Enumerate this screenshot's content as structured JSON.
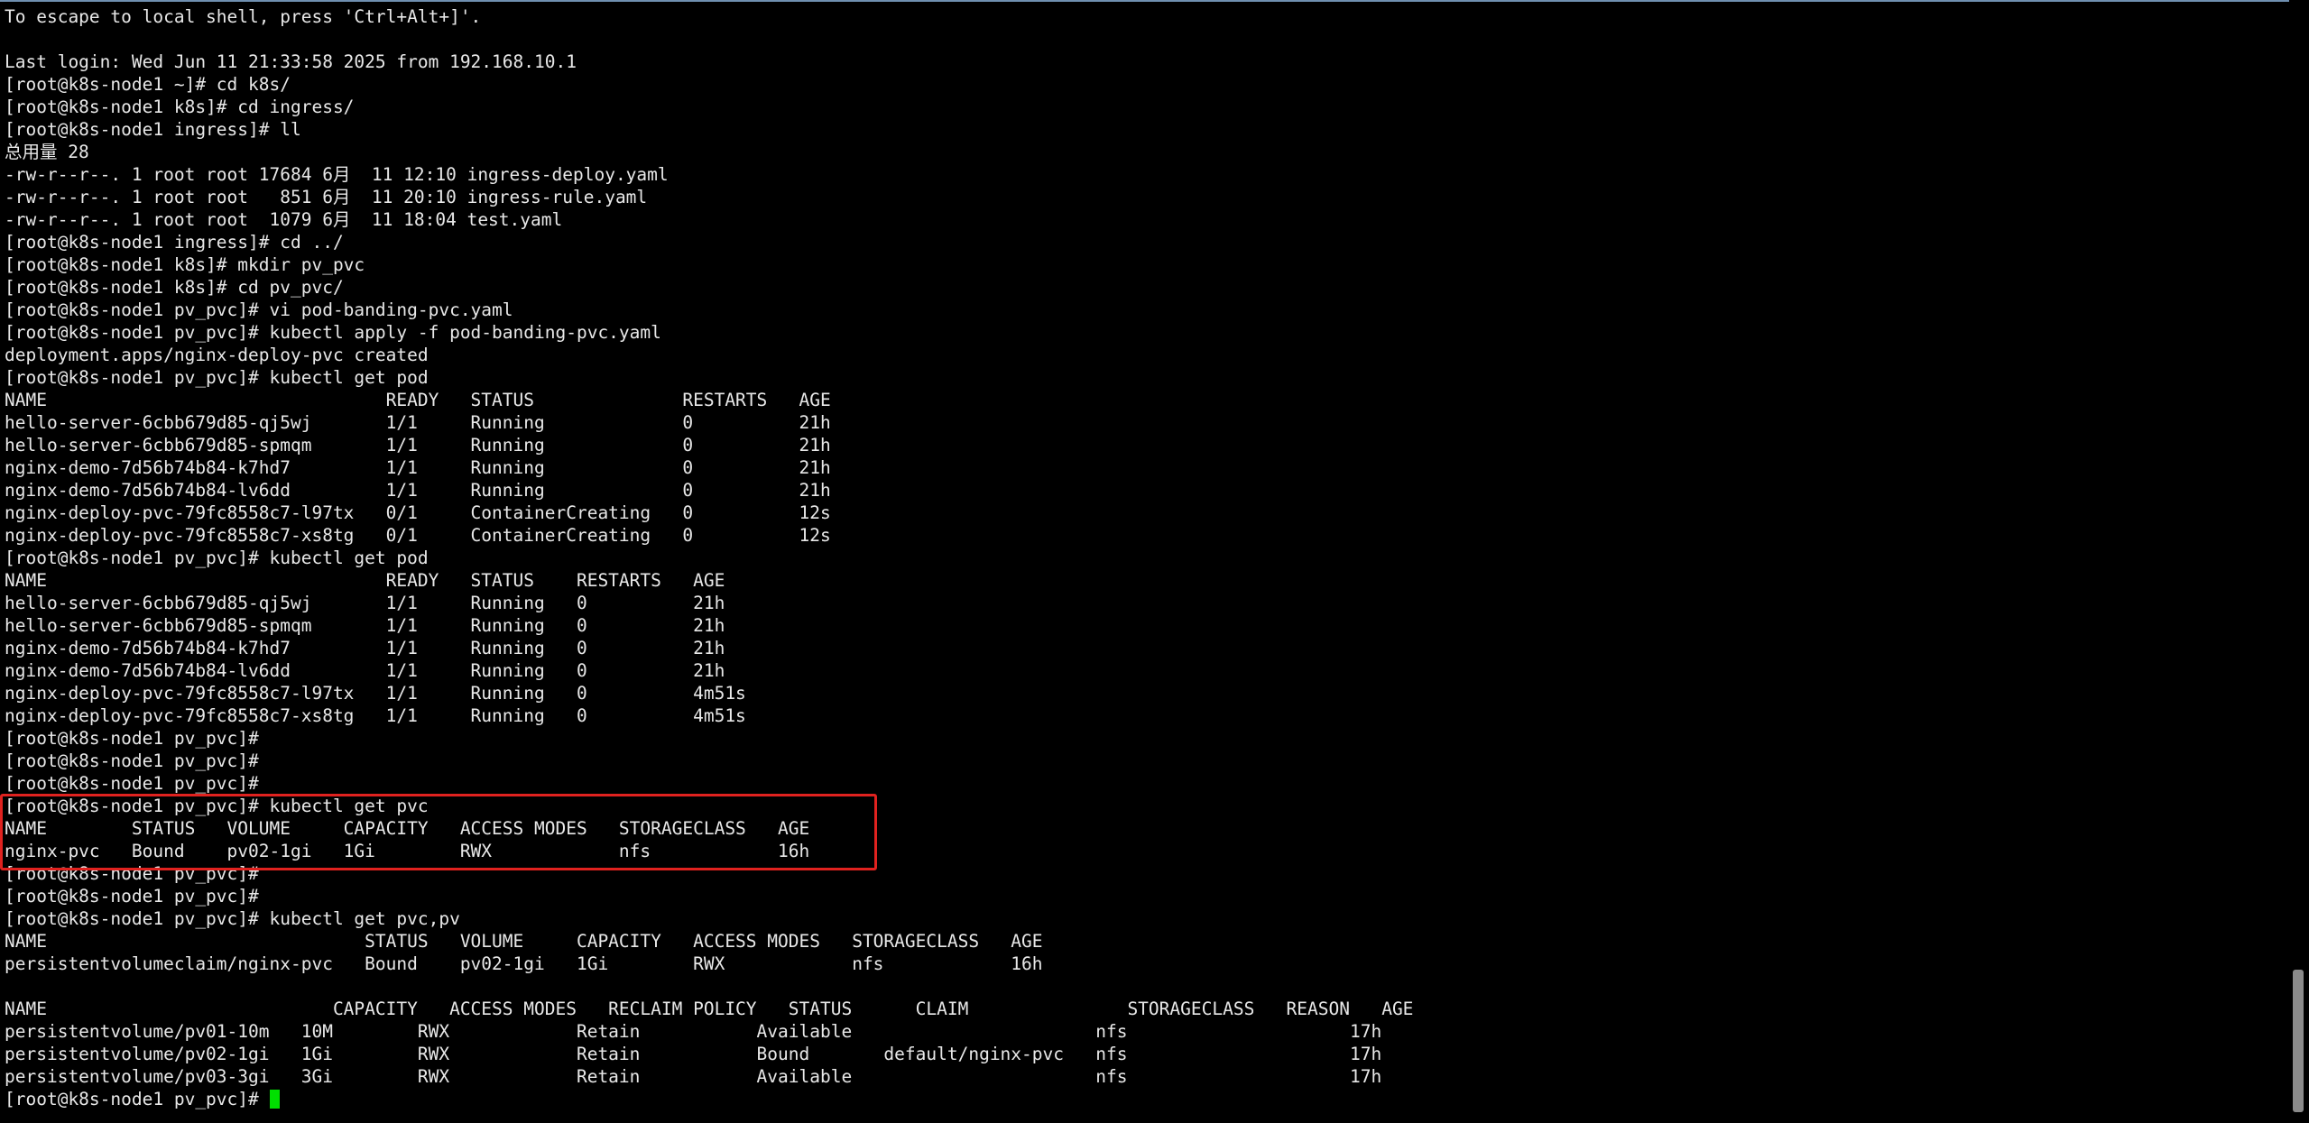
{
  "terminal": {
    "lines": [
      "To escape to local shell, press 'Ctrl+Alt+]'.",
      "",
      "Last login: Wed Jun 11 21:33:58 2025 from 192.168.10.1",
      "[root@k8s-node1 ~]# cd k8s/",
      "[root@k8s-node1 k8s]# cd ingress/",
      "[root@k8s-node1 ingress]# ll",
      "总用量 28",
      "-rw-r--r--. 1 root root 17684 6月  11 12:10 ingress-deploy.yaml",
      "-rw-r--r--. 1 root root   851 6月  11 20:10 ingress-rule.yaml",
      "-rw-r--r--. 1 root root  1079 6月  11 18:04 test.yaml",
      "[root@k8s-node1 ingress]# cd ../",
      "[root@k8s-node1 k8s]# mkdir pv_pvc",
      "[root@k8s-node1 k8s]# cd pv_pvc/",
      "[root@k8s-node1 pv_pvc]# vi pod-banding-pvc.yaml",
      "[root@k8s-node1 pv_pvc]# kubectl apply -f pod-banding-pvc.yaml",
      "deployment.apps/nginx-deploy-pvc created",
      "[root@k8s-node1 pv_pvc]# kubectl get pod",
      "NAME                                READY   STATUS              RESTARTS   AGE",
      "hello-server-6cbb679d85-qj5wj       1/1     Running             0          21h",
      "hello-server-6cbb679d85-spmqm       1/1     Running             0          21h",
      "nginx-demo-7d56b74b84-k7hd7         1/1     Running             0          21h",
      "nginx-demo-7d56b74b84-lv6dd         1/1     Running             0          21h",
      "nginx-deploy-pvc-79fc8558c7-l97tx   0/1     ContainerCreating   0          12s",
      "nginx-deploy-pvc-79fc8558c7-xs8tg   0/1     ContainerCreating   0          12s",
      "[root@k8s-node1 pv_pvc]# kubectl get pod",
      "NAME                                READY   STATUS    RESTARTS   AGE",
      "hello-server-6cbb679d85-qj5wj       1/1     Running   0          21h",
      "hello-server-6cbb679d85-spmqm       1/1     Running   0          21h",
      "nginx-demo-7d56b74b84-k7hd7         1/1     Running   0          21h",
      "nginx-demo-7d56b74b84-lv6dd         1/1     Running   0          21h",
      "nginx-deploy-pvc-79fc8558c7-l97tx   1/1     Running   0          4m51s",
      "nginx-deploy-pvc-79fc8558c7-xs8tg   1/1     Running   0          4m51s",
      "[root@k8s-node1 pv_pvc]#",
      "[root@k8s-node1 pv_pvc]#",
      "[root@k8s-node1 pv_pvc]#",
      "[root@k8s-node1 pv_pvc]# kubectl get pvc",
      "NAME        STATUS   VOLUME     CAPACITY   ACCESS MODES   STORAGECLASS   AGE",
      "nginx-pvc   Bound    pv02-1gi   1Gi        RWX            nfs            16h",
      "[root@k8s-node1 pv_pvc]#",
      "[root@k8s-node1 pv_pvc]#",
      "[root@k8s-node1 pv_pvc]# kubectl get pvc,pv",
      "NAME                              STATUS   VOLUME     CAPACITY   ACCESS MODES   STORAGECLASS   AGE",
      "persistentvolumeclaim/nginx-pvc   Bound    pv02-1gi   1Gi        RWX            nfs            16h",
      "",
      "NAME                           CAPACITY   ACCESS MODES   RECLAIM POLICY   STATUS      CLAIM               STORAGECLASS   REASON   AGE",
      "persistentvolume/pv01-10m   10M        RWX            Retain           Available                       nfs                     17h",
      "persistentvolume/pv02-1gi   1Gi        RWX            Retain           Bound       default/nginx-pvc   nfs                     17h",
      "persistentvolume/pv03-3gi   3Gi        RWX            Retain           Available                       nfs                     17h"
    ],
    "prompt": "[root@k8s-node1 pv_pvc]# ",
    "colors": {
      "background": "#000000",
      "foreground": "#e8e8e8",
      "cursor": "#00e000",
      "highlight_box": "#e0221f"
    }
  }
}
